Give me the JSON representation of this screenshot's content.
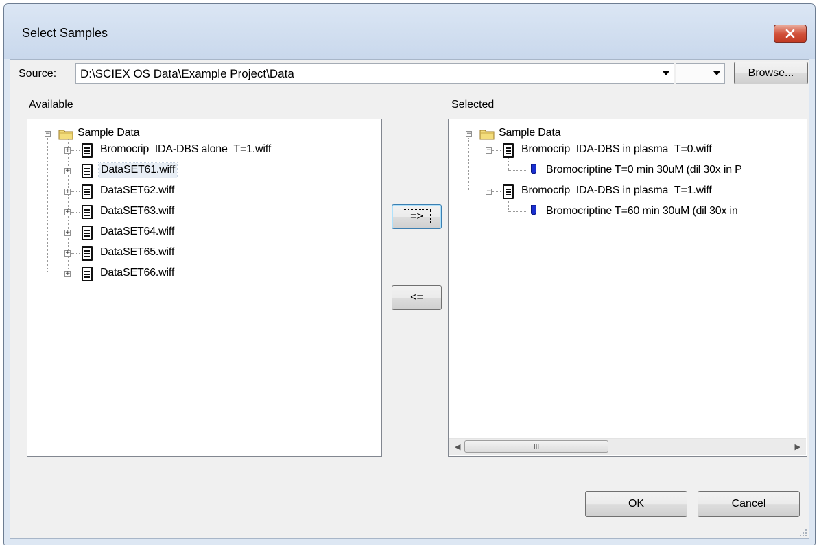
{
  "window": {
    "title": "Select Samples"
  },
  "source": {
    "label": "Source:",
    "path": "D:\\SCIEX OS Data\\Example Project\\Data",
    "secondary_value": "",
    "browse_label": "Browse..."
  },
  "available": {
    "label": "Available",
    "root": "Sample Data",
    "items": [
      "Bromocrip_IDA-DBS alone_T=1.wiff",
      "DataSET61.wiff",
      "DataSET62.wiff",
      "DataSET63.wiff",
      "DataSET64.wiff",
      "DataSET65.wiff",
      "DataSET66.wiff"
    ]
  },
  "selected": {
    "label": "Selected",
    "root": "Sample Data",
    "files": [
      {
        "name": "Bromocrip_IDA-DBS in plasma_T=0.wiff",
        "sample": "Bromocriptine T=0 min  30uM (dil 30x in P"
      },
      {
        "name": "Bromocrip_IDA-DBS in plasma_T=1.wiff",
        "sample": "Bromocriptine T=60 min  30uM (dil 30x in"
      }
    ]
  },
  "buttons": {
    "add": "=>",
    "remove": "<=",
    "ok": "OK",
    "cancel": "Cancel"
  },
  "scrollbar": {
    "thumb_grip": "III"
  },
  "icons": {
    "close": "close-icon",
    "dropdown": "chevron-down-icon",
    "folder": "folder-icon",
    "file": "document-icon",
    "sample": "vial-icon"
  }
}
